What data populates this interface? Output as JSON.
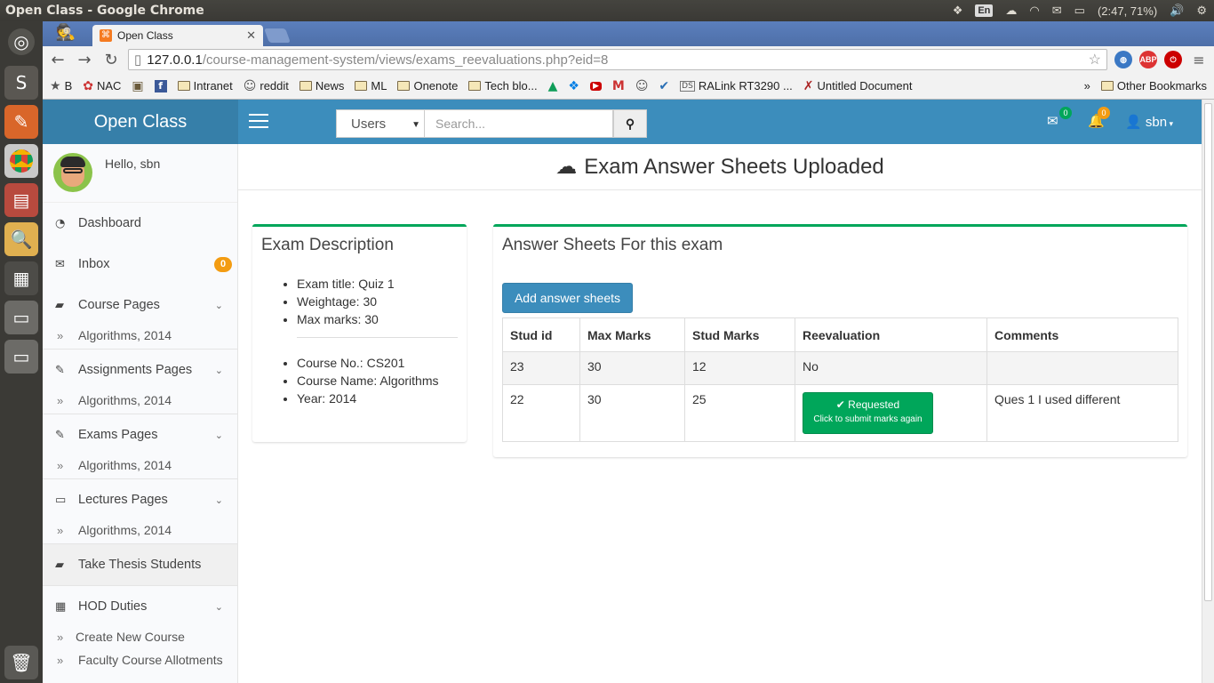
{
  "window": {
    "title": "Open Class - Google Chrome"
  },
  "tray": {
    "lang": "En",
    "battery": "(2:47, 71%)"
  },
  "browser": {
    "tab_title": "Open Class",
    "url_host": "127.0.0.1",
    "url_path": "/course-management-system/views/exams_reevaluations.php?eid=8",
    "bookmarks": [
      {
        "label": "B",
        "icon": "star-icon"
      },
      {
        "label": "NAC",
        "icon": "nac-icon"
      },
      {
        "label": "",
        "icon": "app-icon"
      },
      {
        "label": "",
        "icon": "facebook-icon"
      },
      {
        "label": "Intranet",
        "icon": "folder-icon"
      },
      {
        "label": "reddit",
        "icon": "reddit-icon"
      },
      {
        "label": "News",
        "icon": "folder-icon"
      },
      {
        "label": "ML",
        "icon": "folder-icon"
      },
      {
        "label": "Onenote",
        "icon": "folder-icon"
      },
      {
        "label": "Tech blo...",
        "icon": "folder-icon"
      },
      {
        "label": "",
        "icon": "drive-icon"
      },
      {
        "label": "",
        "icon": "dropbox-icon"
      },
      {
        "label": "",
        "icon": "youtube-icon"
      },
      {
        "label": "",
        "icon": "gmail-icon"
      },
      {
        "label": "",
        "icon": "reddit-icon"
      },
      {
        "label": "",
        "icon": "app-icon"
      },
      {
        "label": "RALink RT3290 ...",
        "icon": "ds-icon"
      },
      {
        "label": "Untitled Document",
        "icon": "doc-icon"
      }
    ],
    "bookmarks_more": "»",
    "other_bookmarks": "Other Bookmarks"
  },
  "app": {
    "brand": "Open Class",
    "search_select": "Users",
    "search_placeholder": "Search...",
    "mail_count": "0",
    "notif_count": "0",
    "username": "sbn"
  },
  "sidebar": {
    "greeting": "Hello, sbn",
    "dashboard": "Dashboard",
    "inbox": "Inbox",
    "inbox_count": "0",
    "course_pages": "Course Pages",
    "course_sub": "Algorithms, 2014",
    "assign_pages": "Assignments Pages",
    "assign_sub": "Algorithms, 2014",
    "exams_pages": "Exams Pages",
    "exams_sub": "Algorithms, 2014",
    "lectures_pages": "Lectures Pages",
    "lectures_sub": "Algorithms, 2014",
    "thesis": "Take Thesis Students",
    "hod": "HOD Duties",
    "hod_sub1": "Create New Course",
    "hod_sub2": "Faculty Course Allotments"
  },
  "content": {
    "page_title": "Exam Answer Sheets Uploaded",
    "desc_title": "Exam Description",
    "exam_title": "Exam title: Quiz 1",
    "weightage": "Weightage: 30",
    "max_marks": "Max marks: 30",
    "course_no": "Course No.: CS201",
    "course_name": "Course Name: Algorithms",
    "year": "Year: 2014",
    "sheets_title": "Answer Sheets For this exam",
    "add_btn": "Add answer sheets",
    "table": {
      "headers": [
        "Stud id",
        "Max Marks",
        "Stud Marks",
        "Reevaluation",
        "Comments"
      ],
      "rows": [
        {
          "stud_id": "23",
          "max": "30",
          "stud": "12",
          "reeval": "No",
          "comment": ""
        },
        {
          "stud_id": "22",
          "max": "30",
          "stud": "25",
          "reeval_btn": "Requested",
          "reeval_sub": "Click to submit marks again",
          "comment": "Ques 1 I used different"
        }
      ]
    }
  }
}
